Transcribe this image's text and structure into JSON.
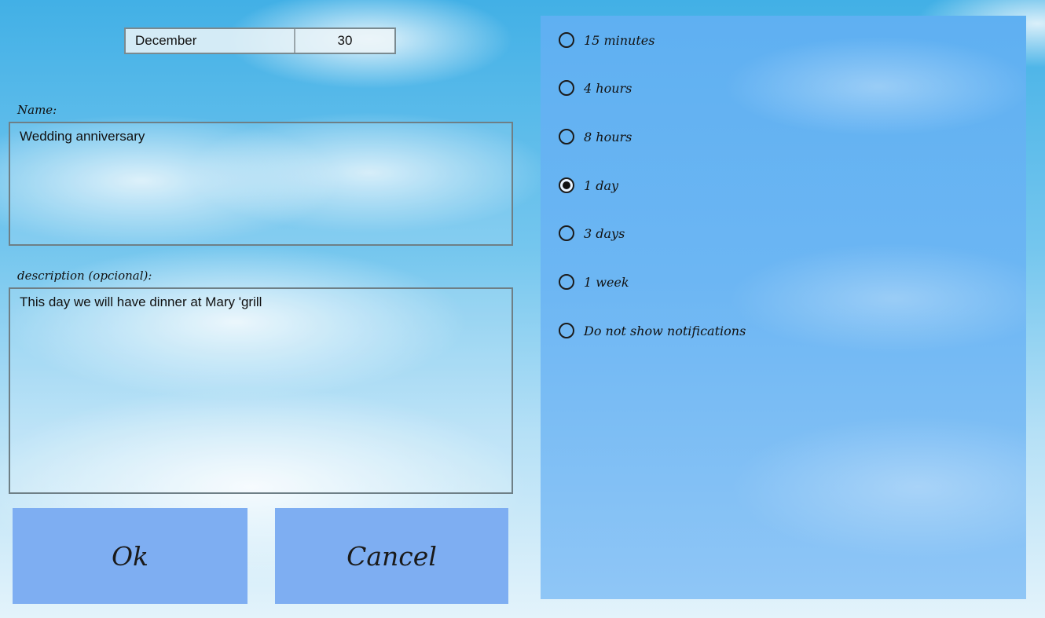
{
  "date": {
    "month": "December",
    "day": "30"
  },
  "name": {
    "label": "Name:",
    "value": "Wedding anniversary"
  },
  "description": {
    "label": "description (opcional):",
    "value": "This day we will have dinner at Mary 'grill"
  },
  "buttons": {
    "ok": "Ok",
    "cancel": "Cancel"
  },
  "notifications": {
    "options": [
      {
        "label": "15 minutes",
        "checked": false
      },
      {
        "label": "4 hours",
        "checked": false
      },
      {
        "label": "8 hours",
        "checked": false
      },
      {
        "label": "1 day",
        "checked": true
      },
      {
        "label": "3 days",
        "checked": false
      },
      {
        "label": "1 week",
        "checked": false
      },
      {
        "label": "Do not show notifications",
        "checked": false
      }
    ]
  }
}
